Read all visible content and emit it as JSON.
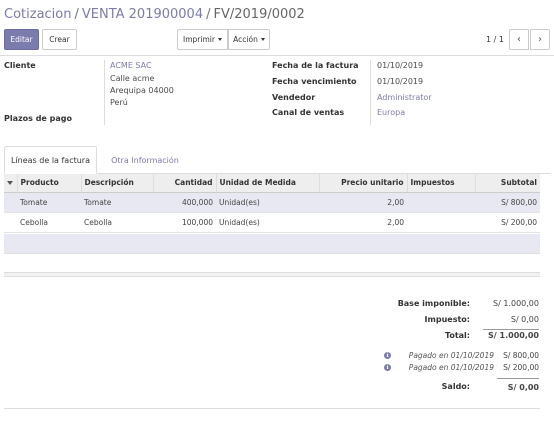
{
  "breadcrumb": {
    "items": [
      "Cotizacion",
      "VENTA 201900004"
    ],
    "current": "FV/2019/0002",
    "separator": "/"
  },
  "toolbar": {
    "edit_label": "Editar",
    "create_label": "Crear",
    "print_label": "Imprimir",
    "action_label": "Acción",
    "pager": "1 / 1"
  },
  "form": {
    "cliente_label": "Cliente",
    "cliente_name": "ACME SAC",
    "address": [
      "Calle acme",
      "Arequipa 04000",
      "Perú"
    ],
    "plazos_label": "Plazos de pago",
    "fecha_factura_label": "Fecha de la factura",
    "fecha_factura": "01/10/2019",
    "fecha_venc_label": "Fecha vencimiento",
    "fecha_venc": "01/10/2019",
    "vendedor_label": "Vendedor",
    "vendedor": "Administrator",
    "canal_label": "Canal de ventas",
    "canal": "Europa"
  },
  "tabs": [
    {
      "label": "Líneas de la factura",
      "active": true
    },
    {
      "label": "Otra Información",
      "active": false
    }
  ],
  "table": {
    "headers": [
      "Producto",
      "Descripción",
      "Cantidad",
      "Unidad de Medida",
      "Precio unitario",
      "Impuestos",
      "Subtotal"
    ],
    "rows": [
      {
        "producto": "Tomate",
        "descripcion": "Tomate",
        "cantidad": "400,000",
        "unidad": "Unidad(es)",
        "precio": "2,00",
        "impuestos": "",
        "subtotal": "S/ 800,00"
      },
      {
        "producto": "Cebolla",
        "descripcion": "Cebolla",
        "cantidad": "100,000",
        "unidad": "Unidad(es)",
        "precio": "2,00",
        "impuestos": "",
        "subtotal": "S/ 200,00"
      }
    ]
  },
  "totals": {
    "base_label": "Base imponible:",
    "base": "S/ 1.000,00",
    "impuesto_label": "Impuesto:",
    "impuesto": "S/ 0,00",
    "total_label": "Total:",
    "total": "S/ 1.000,00",
    "payments": [
      {
        "label": "Pagado en 01/10/2019",
        "amount": "S/ 800,00"
      },
      {
        "label": "Pagado en 01/10/2019",
        "amount": "S/ 200,00"
      }
    ],
    "saldo_label": "Saldo:",
    "saldo": "S/ 0,00"
  },
  "icons": {
    "prev": "chevron-left-icon",
    "next": "chevron-right-icon",
    "info": "info-icon",
    "sort": "caret-down-icon"
  },
  "colors": {
    "accent": "#7c7bad",
    "selected_row": "#e8e8f2"
  }
}
